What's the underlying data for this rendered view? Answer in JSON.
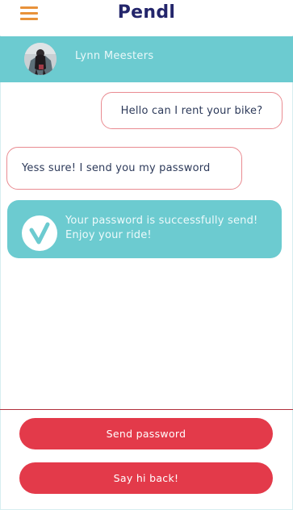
{
  "app": {
    "brand": "Pendl",
    "menu_icon": "hamburger-menu-icon"
  },
  "chat_header": {
    "contact_name": "Lynn Meesters",
    "avatar_icon": "user-avatar"
  },
  "messages": [
    {
      "direction": "outgoing",
      "text": "Hello can I rent your bike?"
    },
    {
      "direction": "incoming",
      "text": "Yess sure! I send you my password"
    }
  ],
  "notice": {
    "icon": "checkmark-icon",
    "line1": "Your password is successfully send!",
    "line2": "Enjoy your ride!"
  },
  "actions": {
    "send_password": "Send password",
    "say_hi_back": "Say hi back!"
  },
  "colors": {
    "brand_text": "#23256b",
    "menu_accent": "#e8923a",
    "teal": "#6ccbd0",
    "bubble_border": "#e98b91",
    "button_red": "#e33a4a"
  }
}
